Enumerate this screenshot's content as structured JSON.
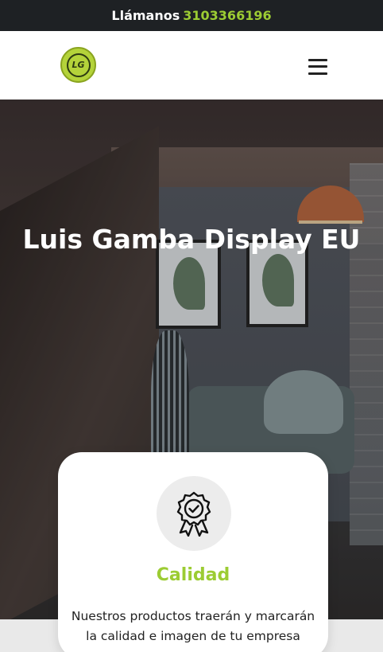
{
  "topbar": {
    "call_label": "Llámanos",
    "phone": "3103366196"
  },
  "header": {
    "logo_text": "LG",
    "logo_icon": "company-logo",
    "menu_icon": "hamburger-menu-icon"
  },
  "hero": {
    "title": "Luis Gamba Display EU"
  },
  "feature_card": {
    "icon": "quality-award-badge-icon",
    "title": "Calidad",
    "text": "Nuestros productos traerán y marcarán la calidad e imagen de tu empresa"
  },
  "colors": {
    "accent": "#9ccc33",
    "topbar_bg": "#1e2124",
    "white": "#ffffff"
  }
}
